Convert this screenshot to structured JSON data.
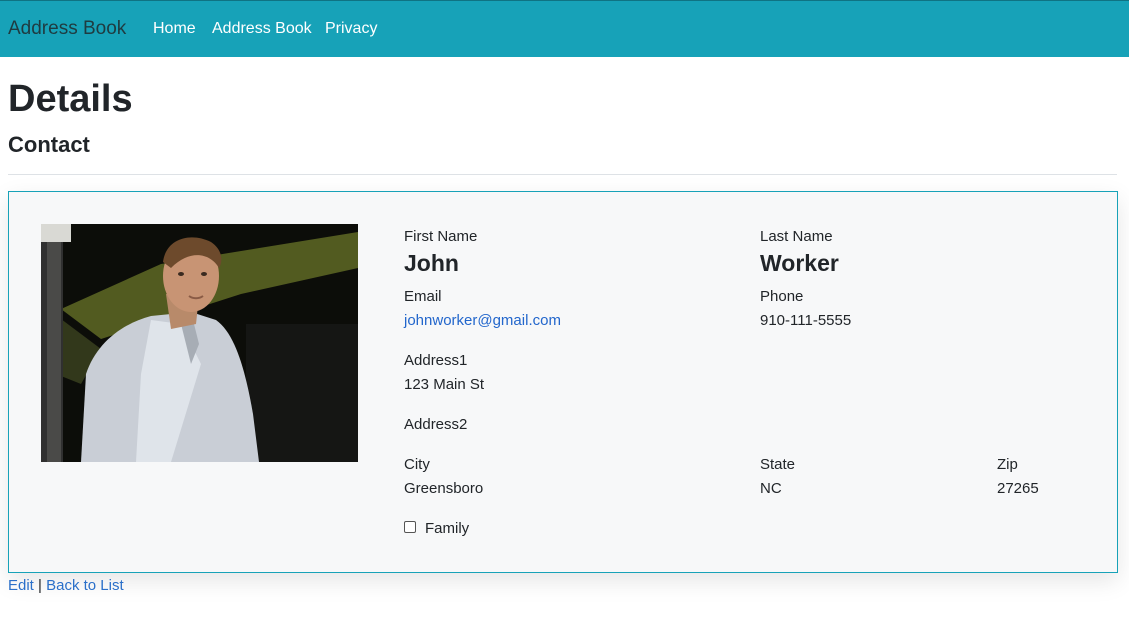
{
  "navbar": {
    "brand": "Address Book",
    "links": [
      "Home",
      "Address Book",
      "Privacy"
    ]
  },
  "page": {
    "title": "Details",
    "subtitle": "Contact"
  },
  "contact": {
    "first_name_label": "First Name",
    "first_name": "John",
    "last_name_label": "Last Name",
    "last_name": "Worker",
    "email_label": "Email",
    "email": "johnworker@gmail.com",
    "phone_label": "Phone",
    "phone": "910-111-5555",
    "address1_label": "Address1",
    "address1": "123 Main St",
    "address2_label": "Address2",
    "address2": "",
    "city_label": "City",
    "city": "Greensboro",
    "state_label": "State",
    "state": "NC",
    "zip_label": "Zip",
    "zip": "27265",
    "family_label": "Family",
    "family_checked": false
  },
  "footer": {
    "edit": "Edit",
    "separator": "|",
    "back": "Back to List"
  },
  "colors": {
    "navbar": "#17a2b8",
    "link": "#2266cc"
  }
}
